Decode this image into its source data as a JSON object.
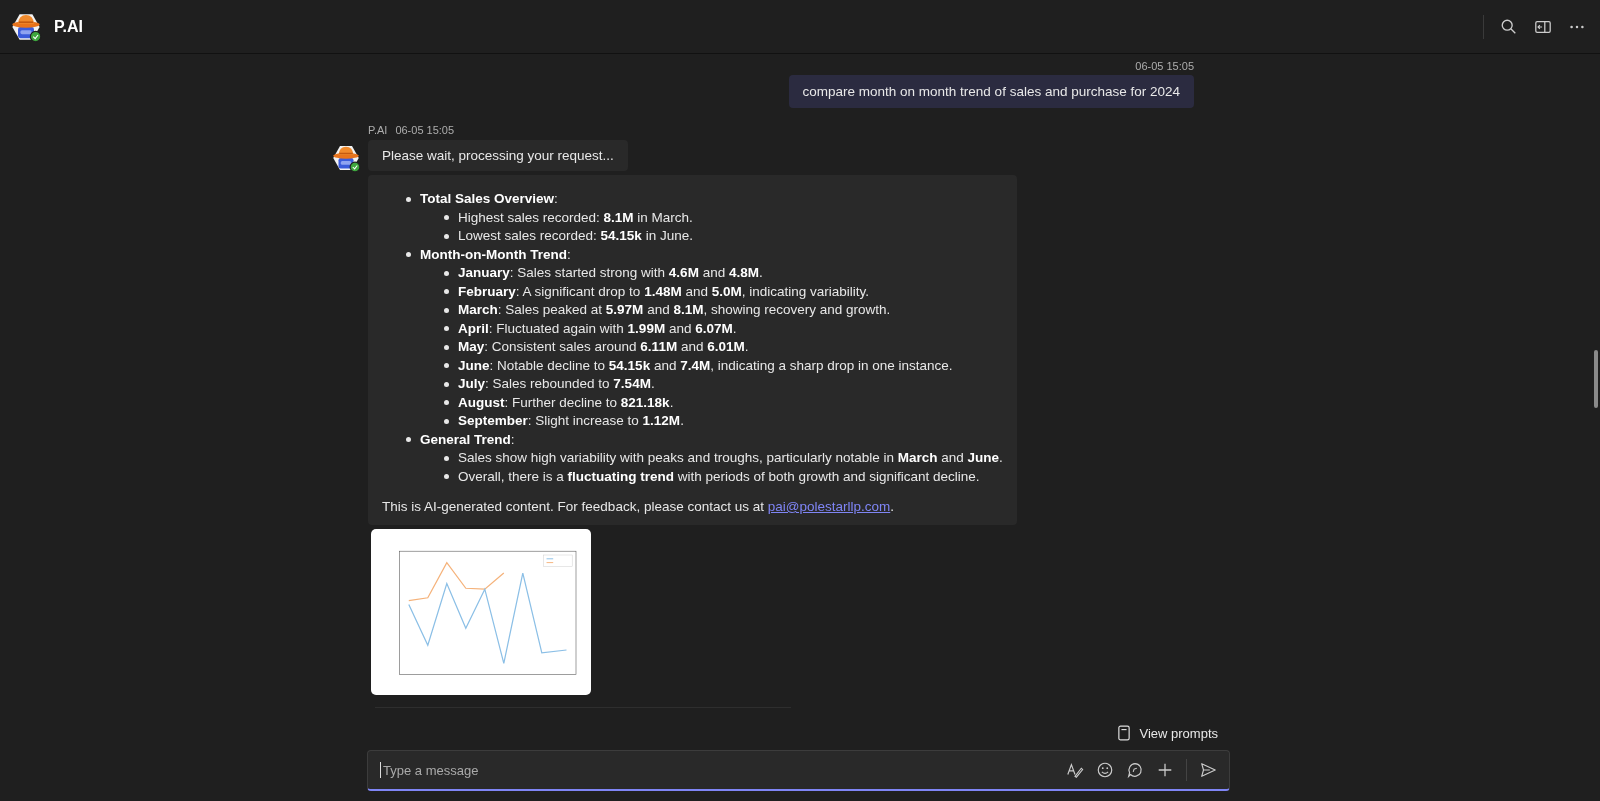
{
  "header": {
    "title": "P.AI",
    "online": true
  },
  "messages": [
    {
      "kind": "user",
      "time": "06-05 15:05",
      "text": "compare month on month trend of sales and purchase for 2024"
    },
    {
      "kind": "bot",
      "sender": "P.AI",
      "time": "06-05 15:05",
      "text": "Please wait, processing your request..."
    },
    {
      "kind": "bot-list",
      "items": [
        {
          "text": "**Total Sales Overview**:",
          "children": [
            {
              "text": "Highest sales recorded: **8.1M** in March."
            },
            {
              "text": "Lowest sales recorded: **54.15k** in June."
            }
          ]
        },
        {
          "text": "**Month-on-Month Trend**:",
          "children": [
            {
              "text": "**January**: Sales started strong with **4.6M** and **4.8M**."
            },
            {
              "text": "**February**: A significant drop to **1.48M** and **5.0M**, indicating variability."
            },
            {
              "text": "**March**: Sales peaked at **5.97M** and **8.1M**, showing recovery and growth."
            },
            {
              "text": "**April**: Fluctuated again with **1.99M** and **6.07M**."
            },
            {
              "text": "**May**: Consistent sales around **6.11M** and **6.01M**."
            },
            {
              "text": "**June**: Notable decline to **54.15k** and **7.4M**, indicating a sharp drop in one instance."
            },
            {
              "text": "**July**: Sales rebounded to **7.54M**."
            },
            {
              "text": "**August**: Further decline to **821.18k**."
            },
            {
              "text": "**September**: Slight increase to **1.12M**."
            }
          ]
        },
        {
          "text": "**General Trend**:",
          "children": [
            {
              "text": "Sales show high variability with peaks and troughs, particularly notable in **March** and **June**."
            },
            {
              "text": "Overall, there is a **fluctuating trend** with periods of both growth and significant decline."
            }
          ]
        }
      ],
      "footer": {
        "text": "This is AI-generated content. For feedback, please contact us at ",
        "link": "pai@polestarllp.com",
        "end": "."
      }
    },
    {
      "image": {
        "kind": "picture"
      }
    }
  ],
  "prompts_button": "View prompts",
  "composer": {
    "placeholder": "Type a message"
  }
}
